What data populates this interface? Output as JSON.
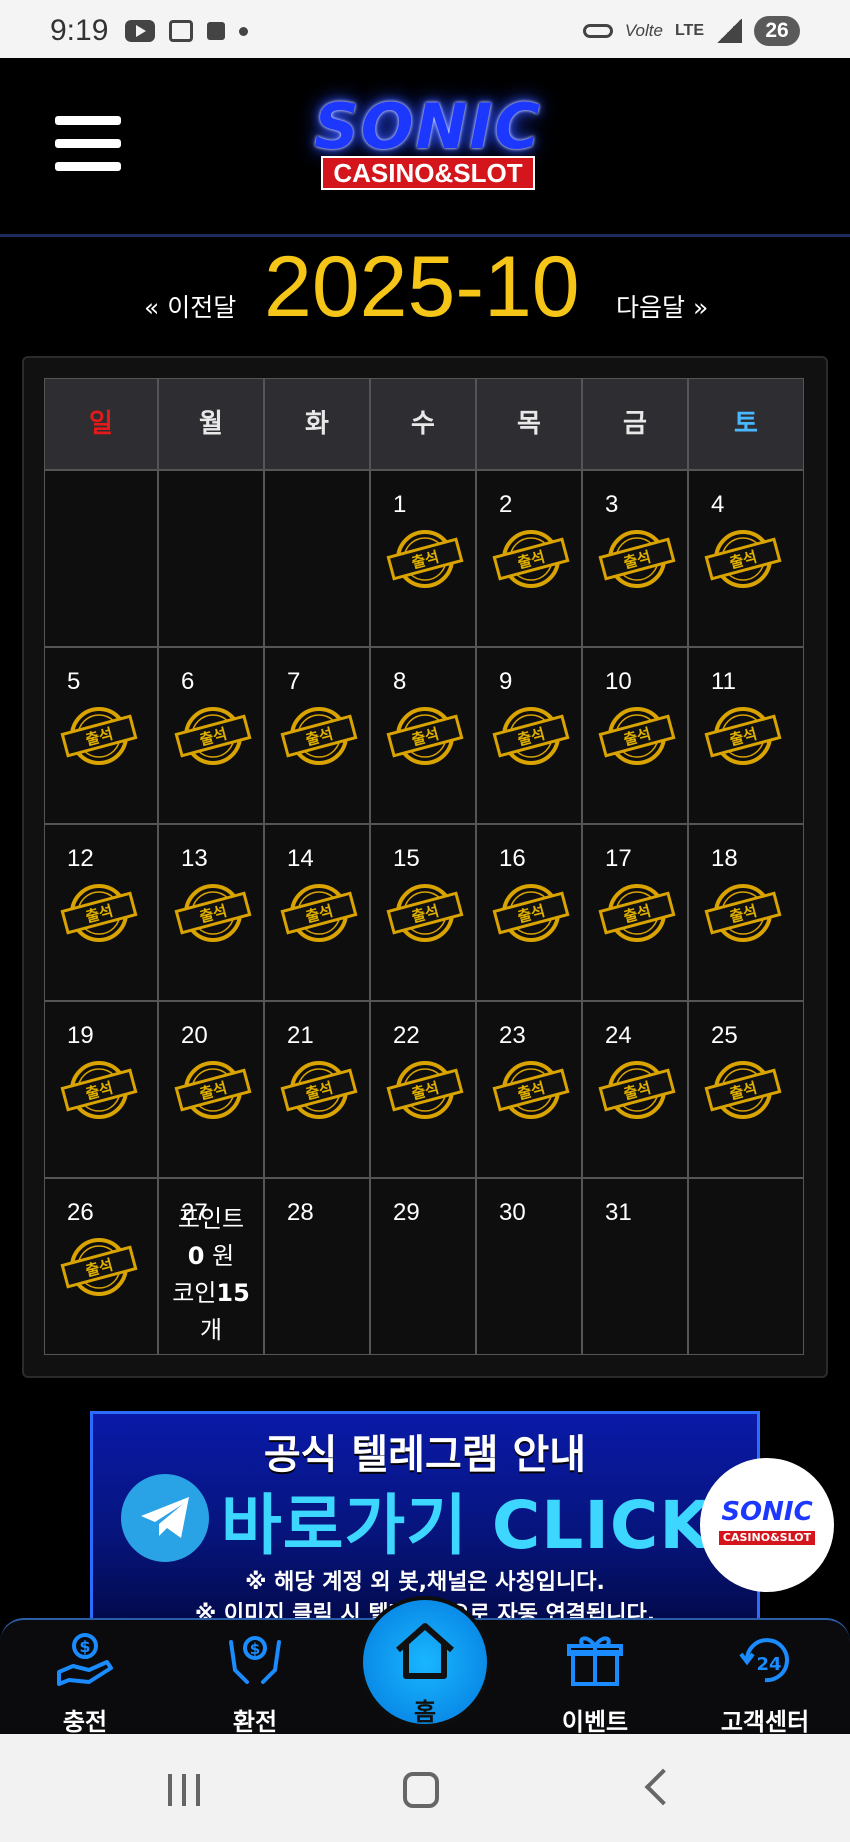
{
  "status_bar": {
    "time": "9:19",
    "lte": "LTE",
    "volte": "Volte",
    "battery": "26"
  },
  "header": {
    "logo_main": "SONIC",
    "logo_sub": "CASINO&SLOT"
  },
  "month_nav": {
    "prev_label": "« 이전달",
    "month": "2025-10",
    "next_label": "다음달 »"
  },
  "calendar": {
    "weekdays": [
      "일",
      "월",
      "화",
      "수",
      "목",
      "금",
      "토"
    ],
    "weekday_colors": [
      "#e21a1a",
      "#e8e8e8",
      "#e8e8e8",
      "#e8e8e8",
      "#e8e8e8",
      "#e8e8e8",
      "#4ab8ff"
    ],
    "stamp_label": "출석",
    "attended_until": 26,
    "rows": [
      [
        "",
        "",
        "",
        "1",
        "2",
        "3",
        "4"
      ],
      [
        "5",
        "6",
        "7",
        "8",
        "9",
        "10",
        "11"
      ],
      [
        "12",
        "13",
        "14",
        "15",
        "16",
        "17",
        "18"
      ],
      [
        "19",
        "20",
        "21",
        "22",
        "23",
        "24",
        "25"
      ],
      [
        "26",
        "27",
        "28",
        "29",
        "30",
        "31",
        ""
      ]
    ],
    "today_points": {
      "line1": "포인트",
      "line2_num": "0",
      "line2_unit": " 원",
      "line3_pre": "코인",
      "line3_num": "15",
      "line4": "개"
    }
  },
  "banner": {
    "title": "공식 텔레그램 안내",
    "cta": "바로가기 CLICK",
    "note1": "※ 해당 계정 외 봇,채널은 사칭입니다.",
    "note2": "※ 이미지 클릭 시 텔레그램으로 자동 연결됩니다."
  },
  "floating_logo": {
    "main": "SONIC",
    "sub": "CASINO&SLOT"
  },
  "bottom_nav": {
    "items": [
      {
        "label": "충전",
        "icon": "deposit-icon"
      },
      {
        "label": "환전",
        "icon": "withdraw-icon"
      },
      {
        "label": "홈",
        "icon": "home-icon"
      },
      {
        "label": "이벤트",
        "icon": "gift-icon"
      },
      {
        "label": "고객센터",
        "icon": "support-24-icon"
      }
    ]
  },
  "colors": {
    "accent_gold": "#f5c518",
    "brand_blue": "#1c38ff",
    "nav_blue": "#1a8cff"
  }
}
